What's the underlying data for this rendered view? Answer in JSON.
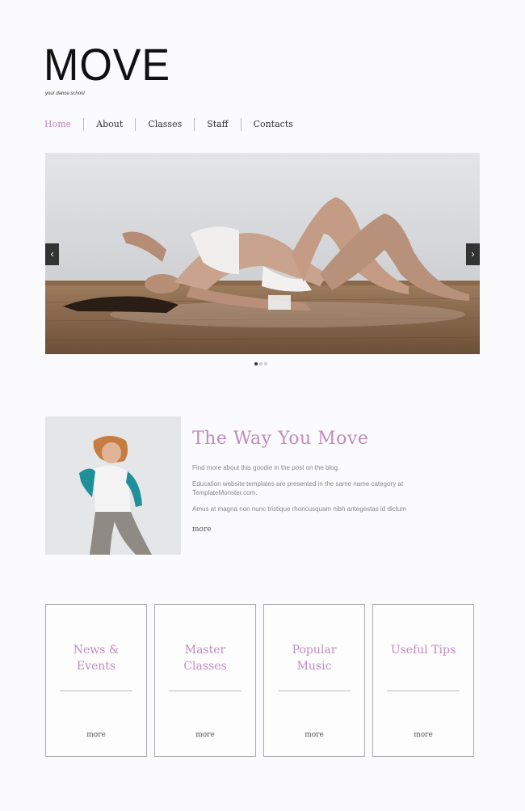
{
  "header": {
    "logo_title": "MOVE",
    "tagline": "your dance school"
  },
  "nav": {
    "items": [
      {
        "label": "Home"
      },
      {
        "label": "About"
      },
      {
        "label": "Classes"
      },
      {
        "label": "Staff"
      },
      {
        "label": "Contacts"
      }
    ]
  },
  "slider": {
    "prev_icon": "chevron-left-icon",
    "next_icon": "chevron-right-icon",
    "prev_glyph": "‹",
    "next_glyph": "›",
    "slide_count": 3,
    "active_slide": 1
  },
  "feature": {
    "title": "The Way You Move",
    "paragraphs": [
      "Find more about this goodie in the post on the blog.",
      "Education website templates are presented in the same name category at TemplateMonster.com.",
      "Amus at magna non nunc tristique rhoncusquam nibh antegestas id dictum"
    ],
    "more_label": "more"
  },
  "boxes": [
    {
      "title": "News & Events",
      "more_label": "more"
    },
    {
      "title": "Master Classes",
      "more_label": "more"
    },
    {
      "title": "Popular Music",
      "more_label": "more"
    },
    {
      "title": "Useful Tips",
      "more_label": "more"
    }
  ],
  "colors": {
    "accent": "#c28bbf",
    "background": "#fbfbfd",
    "logo": "#111111"
  }
}
